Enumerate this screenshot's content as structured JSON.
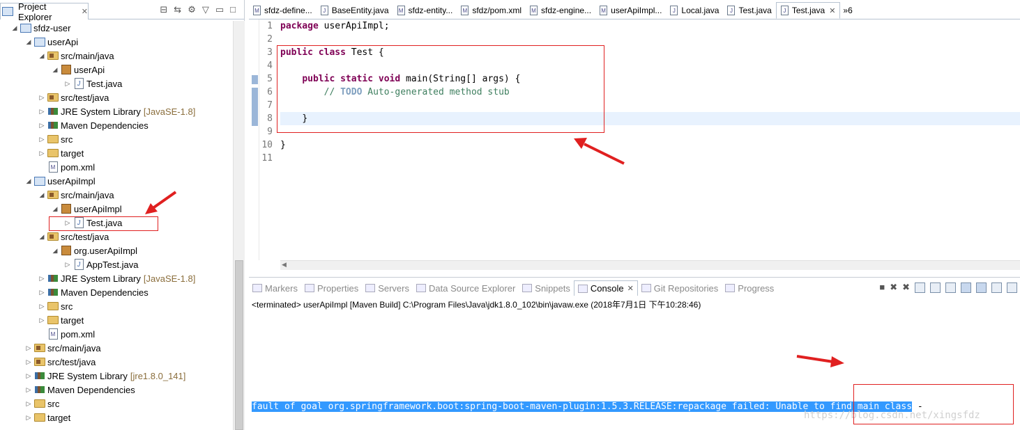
{
  "explorer": {
    "title": "Project Explorer",
    "items": [
      {
        "label": "sfdz-user",
        "deco": "",
        "icon": "project-icon",
        "expanded": true,
        "level": 0
      },
      {
        "label": "userApi",
        "deco": "",
        "icon": "project-icon",
        "expanded": true,
        "level": 1
      },
      {
        "label": "src/main/java",
        "deco": "",
        "icon": "source-folder-icon",
        "expanded": true,
        "level": 2
      },
      {
        "label": "userApi",
        "deco": "",
        "icon": "package-icon",
        "expanded": true,
        "level": 3
      },
      {
        "label": "Test.java",
        "deco": "",
        "icon": "java-file-icon",
        "expanded": false,
        "level": 4
      },
      {
        "label": "src/test/java",
        "deco": "",
        "icon": "source-folder-icon",
        "expanded": false,
        "level": 2
      },
      {
        "label": "JRE System Library",
        "deco": "[JavaSE-1.8]",
        "icon": "library-icon",
        "expanded": false,
        "level": 2
      },
      {
        "label": "Maven Dependencies",
        "deco": "",
        "icon": "library-icon",
        "expanded": false,
        "level": 2
      },
      {
        "label": "src",
        "deco": "",
        "icon": "folder-icon",
        "expanded": false,
        "level": 2
      },
      {
        "label": "target",
        "deco": "",
        "icon": "folder-icon",
        "expanded": false,
        "level": 2
      },
      {
        "label": "pom.xml",
        "deco": "",
        "icon": "xml-file-icon",
        "expanded": null,
        "level": 2
      },
      {
        "label": "userApiImpl",
        "deco": "",
        "icon": "project-icon",
        "expanded": true,
        "level": 1
      },
      {
        "label": "src/main/java",
        "deco": "",
        "icon": "source-folder-icon",
        "expanded": true,
        "level": 2
      },
      {
        "label": "userApiImpl",
        "deco": "",
        "icon": "package-icon",
        "expanded": true,
        "level": 3
      },
      {
        "label": "Test.java",
        "deco": "",
        "icon": "java-file-icon",
        "expanded": false,
        "level": 4
      },
      {
        "label": "src/test/java",
        "deco": "",
        "icon": "source-folder-icon",
        "expanded": true,
        "level": 2
      },
      {
        "label": "org.userApiImpl",
        "deco": "",
        "icon": "package-icon",
        "expanded": true,
        "level": 3
      },
      {
        "label": "AppTest.java",
        "deco": "",
        "icon": "java-file-icon",
        "expanded": false,
        "level": 4
      },
      {
        "label": "JRE System Library",
        "deco": "[JavaSE-1.8]",
        "icon": "library-icon",
        "expanded": false,
        "level": 2
      },
      {
        "label": "Maven Dependencies",
        "deco": "",
        "icon": "library-icon",
        "expanded": false,
        "level": 2
      },
      {
        "label": "src",
        "deco": "",
        "icon": "folder-icon",
        "expanded": false,
        "level": 2
      },
      {
        "label": "target",
        "deco": "",
        "icon": "folder-icon",
        "expanded": false,
        "level": 2
      },
      {
        "label": "pom.xml",
        "deco": "",
        "icon": "xml-file-icon",
        "expanded": null,
        "level": 2
      },
      {
        "label": "src/main/java",
        "deco": "",
        "icon": "source-folder-icon",
        "expanded": false,
        "level": 1
      },
      {
        "label": "src/test/java",
        "deco": "",
        "icon": "source-folder-icon",
        "expanded": false,
        "level": 1
      },
      {
        "label": "JRE System Library",
        "deco": "[jre1.8.0_141]",
        "icon": "library-icon",
        "expanded": false,
        "level": 1
      },
      {
        "label": "Maven Dependencies",
        "deco": "",
        "icon": "library-icon",
        "expanded": false,
        "level": 1
      },
      {
        "label": "src",
        "deco": "",
        "icon": "folder-icon",
        "expanded": false,
        "level": 1
      },
      {
        "label": "target",
        "deco": "",
        "icon": "folder-icon",
        "expanded": false,
        "level": 1
      }
    ]
  },
  "editor": {
    "tabs": [
      {
        "label": "sfdz-define...",
        "icon": "M",
        "active": false
      },
      {
        "label": "BaseEntity.java",
        "icon": "J",
        "active": false
      },
      {
        "label": "sfdz-entity...",
        "icon": "M",
        "active": false
      },
      {
        "label": "sfdz/pom.xml",
        "icon": "M",
        "active": false
      },
      {
        "label": "sfdz-engine...",
        "icon": "M",
        "active": false
      },
      {
        "label": "userApiImpl...",
        "icon": "M",
        "active": false
      },
      {
        "label": "Local.java",
        "icon": "J",
        "active": false
      },
      {
        "label": "Test.java",
        "icon": "J",
        "active": false
      },
      {
        "label": "Test.java",
        "icon": "J",
        "active": true
      }
    ],
    "more_tabs": "»6",
    "line_numbers": [
      "1",
      "2",
      "3",
      "4",
      "5",
      "6",
      "7",
      "8",
      "9",
      "10",
      "11"
    ],
    "code": {
      "l1_kw": "package",
      "l1_rest": " userApiImpl;",
      "l3_kw1": "public",
      "l3_kw2": "class",
      "l3_rest": " Test {",
      "l5_kw1": "public",
      "l5_kw2": "static",
      "l5_kw3": "void",
      "l5_rest": " main(String[] args) {",
      "l6_pre": "// ",
      "l6_todo": "TODO",
      "l6_rest": " Auto-generated method stub",
      "l8": "}",
      "l10": "}"
    }
  },
  "panel": {
    "tabs": [
      {
        "label": "Markers",
        "active": false
      },
      {
        "label": "Properties",
        "active": false
      },
      {
        "label": "Servers",
        "active": false
      },
      {
        "label": "Data Source Explorer",
        "active": false
      },
      {
        "label": "Snippets",
        "active": false
      },
      {
        "label": "Console",
        "active": true
      },
      {
        "label": "Git Repositories",
        "active": false
      },
      {
        "label": "Progress",
        "active": false
      }
    ],
    "terminated": "<terminated> userApiImpl [Maven Build] C:\\Program Files\\Java\\jdk1.8.0_102\\bin\\javaw.exe (2018年7月1日 下午10:28:46)",
    "output_line": "fault of goal org.springframework.boot:spring-boot-maven-plugin:1.5.3.RELEASE:repackage failed: Unable to find main class",
    "output_tail": " -",
    "watermark": "https://blog.csdn.net/xingsfdz"
  },
  "colors": {
    "keyword": "#7f0055",
    "comment": "#3f7f5f",
    "todo": "#7f9fbf",
    "selection": "#3399ff",
    "annotation_red": "#e02020",
    "current_line": "#e8f2fe"
  }
}
